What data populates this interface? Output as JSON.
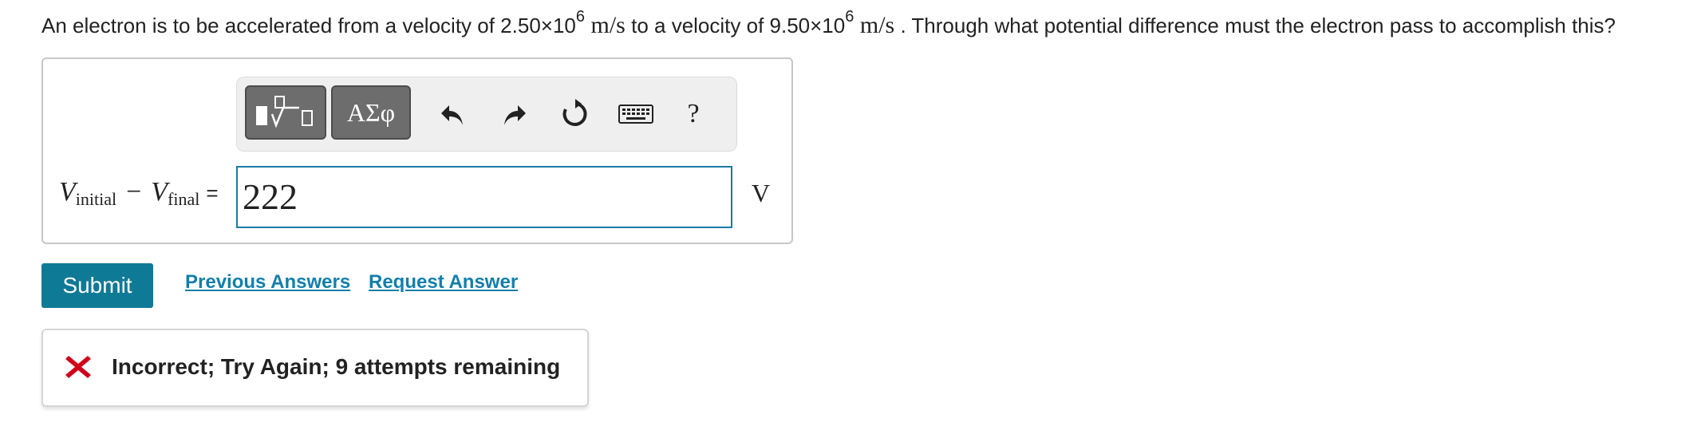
{
  "question": {
    "text_a": "An electron is to be accelerated from a velocity of 2.50×10",
    "exp_a": "6",
    "unit_a": " m/s",
    "text_b": " to a velocity of 9.50×10",
    "exp_b": "6",
    "unit_b": " m/s",
    "text_c": " . Through what potential difference must the electron pass to accomplish this?"
  },
  "toolbar": {
    "symbols_label": "ΑΣφ",
    "help_label": "?"
  },
  "expression": {
    "v1": "V",
    "sub1": "initial",
    "minus": "−",
    "v2": "V",
    "sub2": "final",
    "equals": "="
  },
  "answer": {
    "value": "222",
    "unit": "V"
  },
  "actions": {
    "submit_label": "Submit",
    "previous_label": "Previous Answers",
    "request_label": "Request Answer"
  },
  "feedback": {
    "message": "Incorrect; Try Again; 9 attempts remaining",
    "status_color": "#d0021b"
  },
  "colors": {
    "accent": "#0f7a96",
    "link": "#127fab",
    "input_border": "#1a7aa4"
  }
}
